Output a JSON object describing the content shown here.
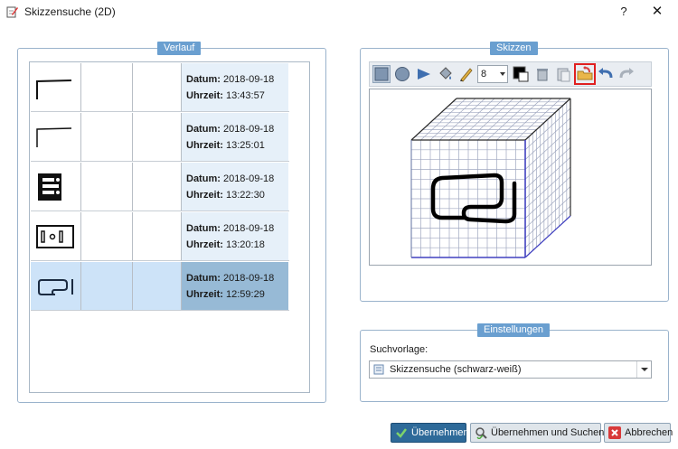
{
  "window": {
    "title": "Skizzensuche (2D)",
    "help": "?",
    "close": "✕"
  },
  "history": {
    "title": "Verlauf",
    "date_label": "Datum:",
    "time_label": "Uhrzeit:",
    "rows": [
      {
        "date": "2018-09-18",
        "time": "13:43:57"
      },
      {
        "date": "2018-09-18",
        "time": "13:25:01"
      },
      {
        "date": "2018-09-18",
        "time": "13:22:30"
      },
      {
        "date": "2018-09-18",
        "time": "13:20:18"
      },
      {
        "date": "2018-09-18",
        "time": "12:59:29"
      }
    ]
  },
  "sketches": {
    "title": "Skizzen",
    "pen_size": "8"
  },
  "settings": {
    "title": "Einstellungen",
    "template_label": "Suchvorlage:",
    "template_value": "Skizzensuche (schwarz-weiß)"
  },
  "buttons": {
    "apply": "Übernehmen",
    "apply_search": "Übernehmen und Suchen",
    "cancel": "Abbrechen"
  },
  "colors": {
    "accent": "#6a9fd0",
    "primary_button": "#2e6a99",
    "selection": "#cde3f8",
    "highlight": "#e02020"
  }
}
